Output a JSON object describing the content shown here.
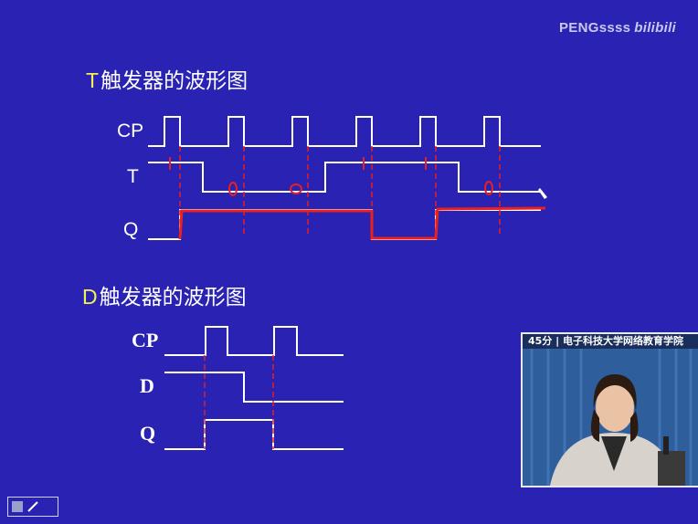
{
  "watermark": {
    "name": "PENGssss",
    "brand": "bilibili"
  },
  "t_section": {
    "letter": "T",
    "rest": "触发器的波形图",
    "labels": {
      "cp": "CP",
      "t": "T",
      "q": "Q"
    }
  },
  "d_section": {
    "letter": "D",
    "rest": "触发器的波形图",
    "labels": {
      "cp": "CP",
      "d": "D",
      "q": "Q"
    }
  },
  "video": {
    "caption": "45分 | 电子科技大学网络教育学院"
  },
  "colors": {
    "background": "#2a22b3",
    "signal": "#ffffff",
    "annotation": "#e8201e",
    "title_letter": "#f4ef52"
  },
  "icons": {
    "corner": "pen-tool-icon"
  }
}
